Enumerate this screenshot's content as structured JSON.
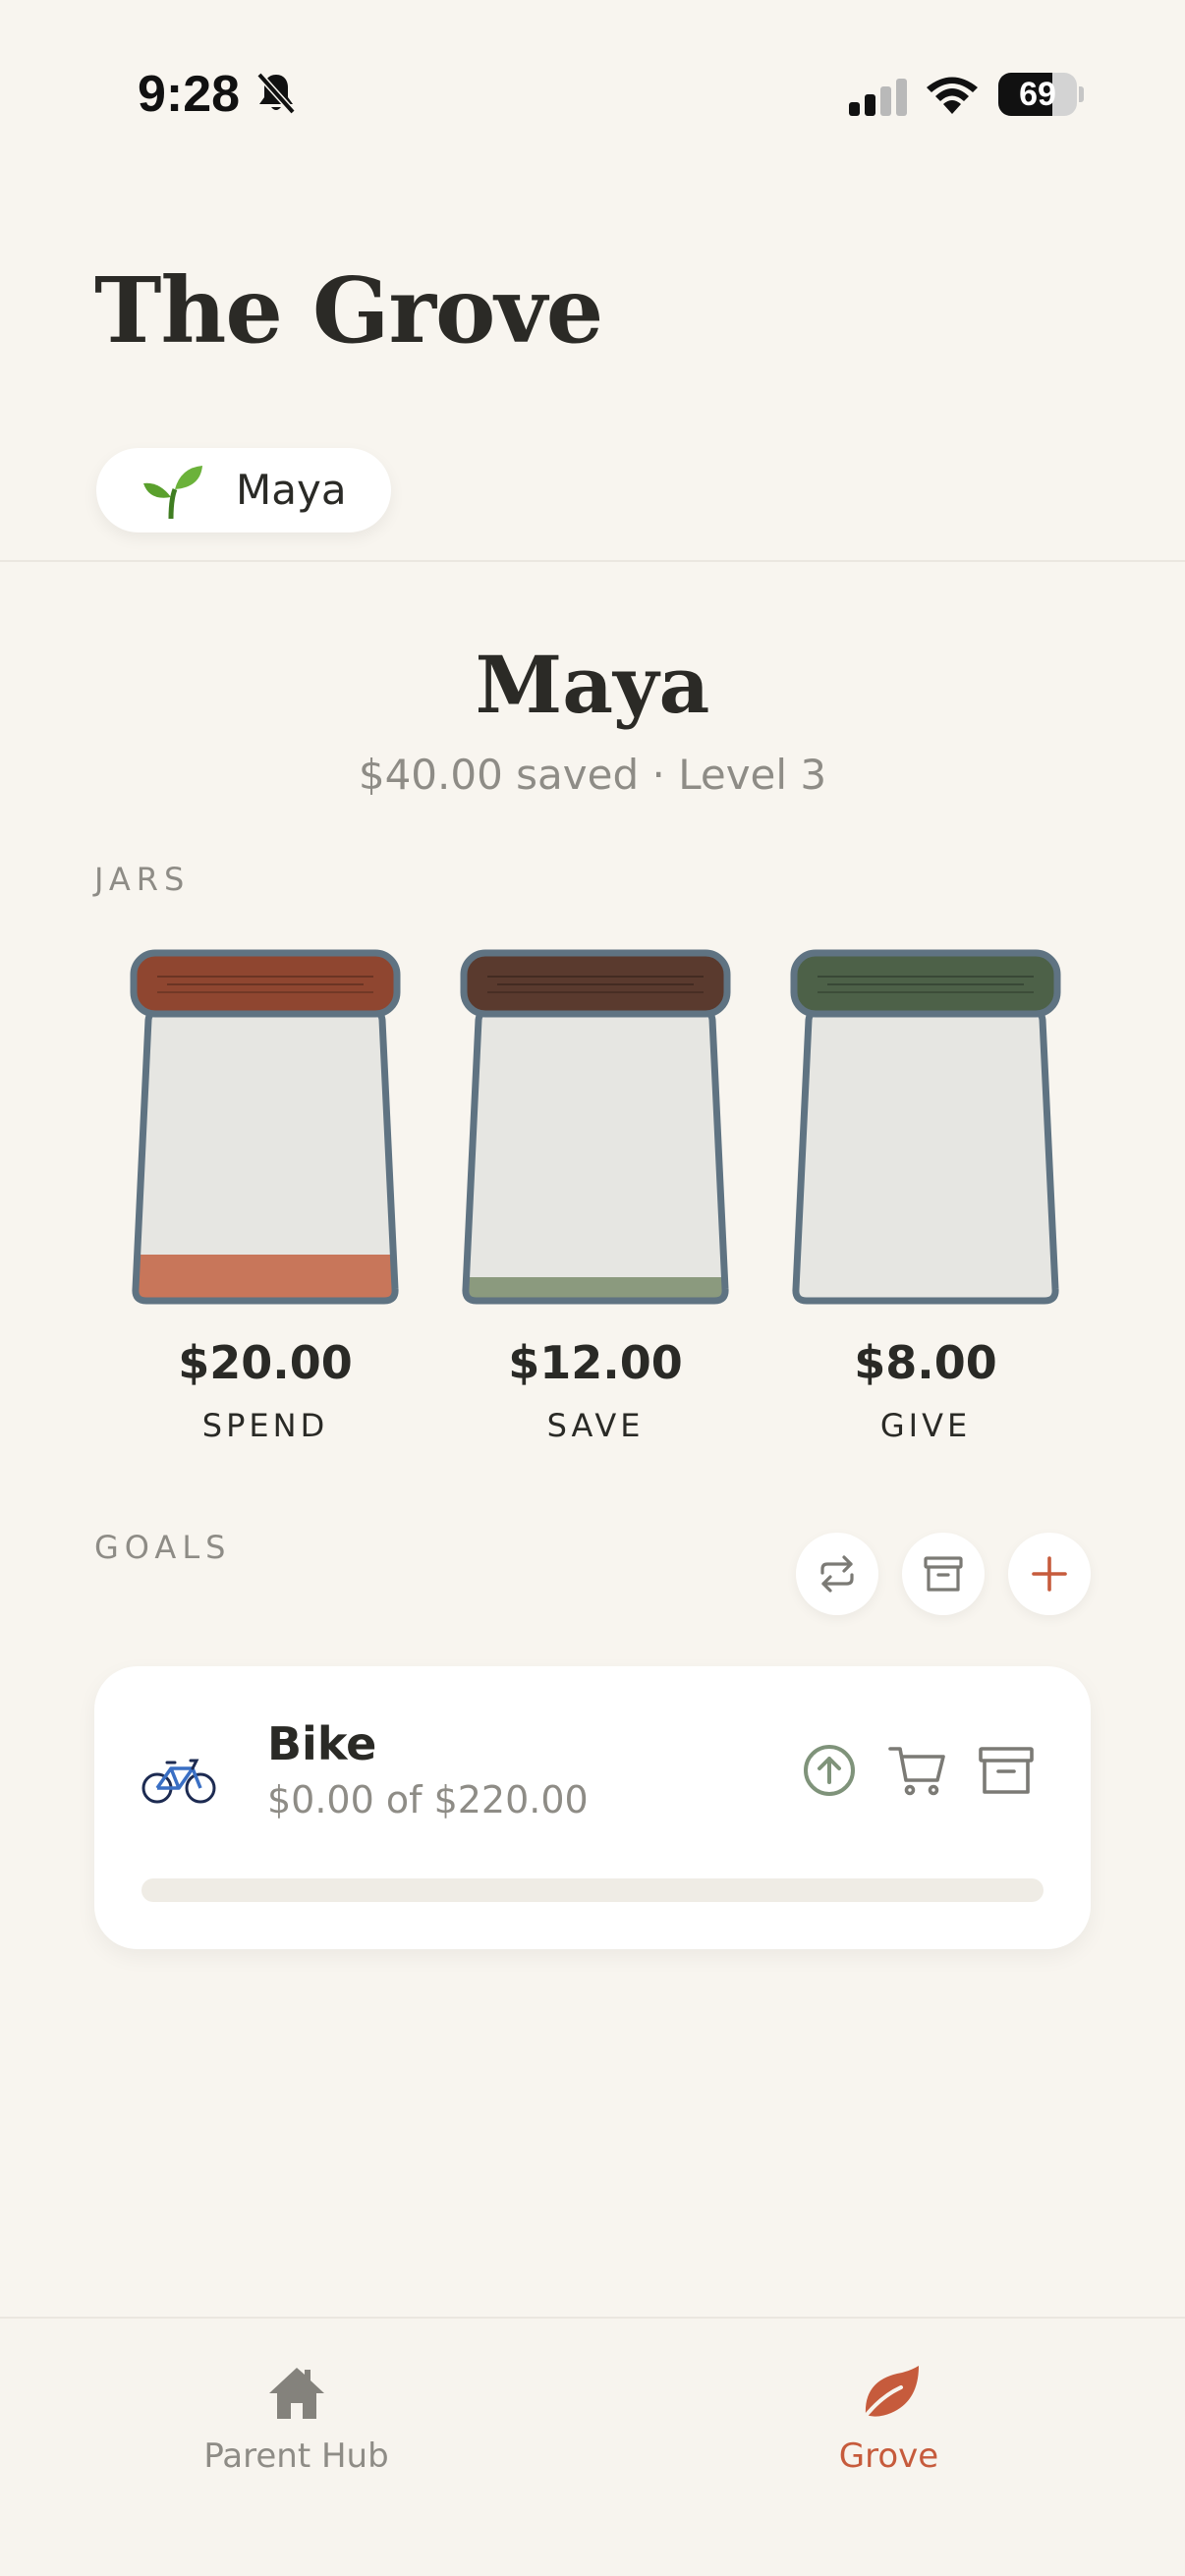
{
  "status": {
    "time": "9:28",
    "battery": "69",
    "battery_level": 0.69
  },
  "header": {
    "title": "The Grove"
  },
  "child_chip": {
    "name": "Maya"
  },
  "profile": {
    "name": "Maya",
    "summary": "$40.00 saved · Level 3"
  },
  "jars": {
    "section_label": "JARS",
    "items": [
      {
        "amount": "$20.00",
        "label": "SPEND",
        "fill": 0.16,
        "lid_color": "#8f4630",
        "fill_color": "#c8765a"
      },
      {
        "amount": "$12.00",
        "label": "SAVE",
        "fill": 0.08,
        "lid_color": "#5a3a2e",
        "fill_color": "#8b9a7e"
      },
      {
        "amount": "$8.00",
        "label": "GIVE",
        "fill": 0.0,
        "lid_color": "#4d6148",
        "fill_color": "#8b9a7e"
      }
    ]
  },
  "goals": {
    "section_label": "GOALS",
    "items": [
      {
        "emoji": "🚲",
        "name": "Bike",
        "progress_text": "$0.00 of $220.00",
        "progress": 0.0
      }
    ]
  },
  "tabs": [
    {
      "label": "Parent Hub",
      "icon": "home-icon",
      "active": false
    },
    {
      "label": "Grove",
      "icon": "leaf-icon",
      "active": true
    }
  ],
  "colors": {
    "accent": "#c65b3c",
    "muted": "#8e8c86",
    "background": "#f8f5ef",
    "jar_outline": "#5f7382"
  }
}
